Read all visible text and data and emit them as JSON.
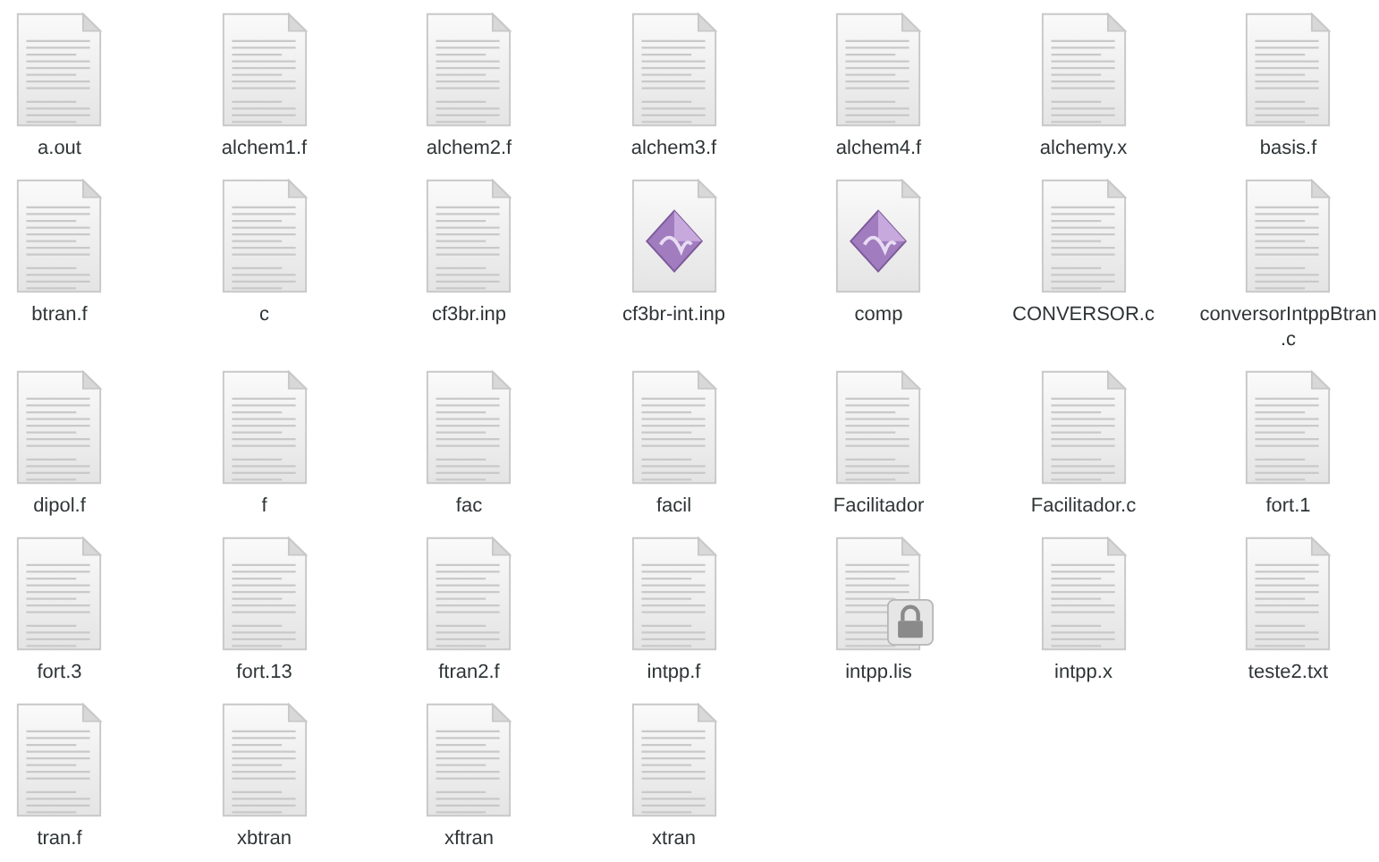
{
  "files": [
    {
      "name": "a.out",
      "kind": "text",
      "locked": false
    },
    {
      "name": "alchem1.f",
      "kind": "text",
      "locked": false
    },
    {
      "name": "alchem2.f",
      "kind": "text",
      "locked": false
    },
    {
      "name": "alchem3.f",
      "kind": "text",
      "locked": false
    },
    {
      "name": "alchem4.f",
      "kind": "text",
      "locked": false
    },
    {
      "name": "alchemy.x",
      "kind": "text",
      "locked": false
    },
    {
      "name": "basis.f",
      "kind": "text",
      "locked": false
    },
    {
      "name": "btran.f",
      "kind": "text",
      "locked": false
    },
    {
      "name": "c",
      "kind": "text",
      "locked": false
    },
    {
      "name": "cf3br.inp",
      "kind": "text",
      "locked": false
    },
    {
      "name": "cf3br-int.inp",
      "kind": "media",
      "locked": false
    },
    {
      "name": "comp",
      "kind": "media",
      "locked": false
    },
    {
      "name": "CONVERSOR.c",
      "kind": "text",
      "locked": false
    },
    {
      "name": "conversorIntppBtran.c",
      "kind": "text",
      "locked": false
    },
    {
      "name": "dipol.f",
      "kind": "text",
      "locked": false
    },
    {
      "name": "f",
      "kind": "text",
      "locked": false
    },
    {
      "name": "fac",
      "kind": "text",
      "locked": false
    },
    {
      "name": "facil",
      "kind": "text",
      "locked": false
    },
    {
      "name": "Facilitador",
      "kind": "text",
      "locked": false
    },
    {
      "name": "Facilitador.c",
      "kind": "text",
      "locked": false
    },
    {
      "name": "fort.1",
      "kind": "text",
      "locked": false
    },
    {
      "name": "fort.3",
      "kind": "text",
      "locked": false
    },
    {
      "name": "fort.13",
      "kind": "text",
      "locked": false
    },
    {
      "name": "ftran2.f",
      "kind": "text",
      "locked": false
    },
    {
      "name": "intpp.f",
      "kind": "text",
      "locked": false
    },
    {
      "name": "intpp.lis",
      "kind": "text",
      "locked": true
    },
    {
      "name": "intpp.x",
      "kind": "text",
      "locked": false
    },
    {
      "name": "teste2.txt",
      "kind": "text",
      "locked": false
    },
    {
      "name": "tran.f",
      "kind": "text",
      "locked": false
    },
    {
      "name": "xbtran",
      "kind": "text",
      "locked": false
    },
    {
      "name": "xftran",
      "kind": "text",
      "locked": false
    },
    {
      "name": "xtran",
      "kind": "text",
      "locked": false
    }
  ]
}
